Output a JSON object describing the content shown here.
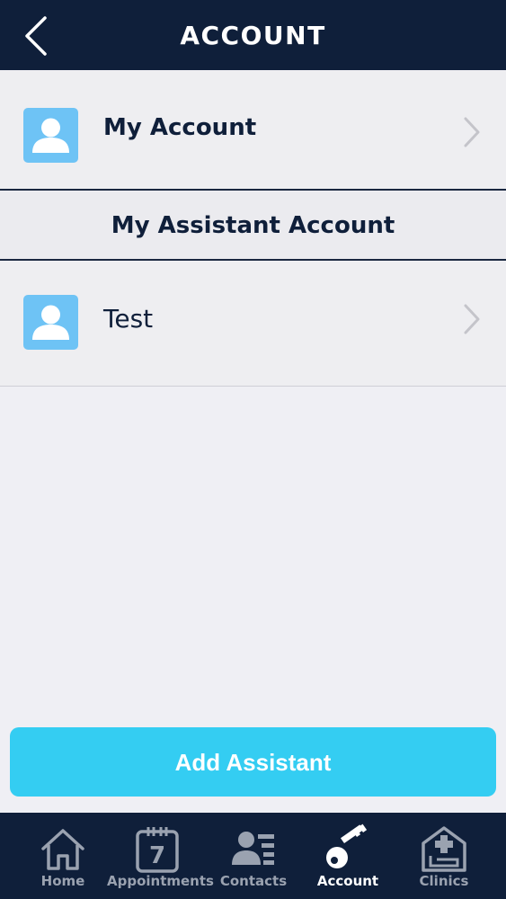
{
  "header": {
    "title": "ACCOUNT"
  },
  "my_account": {
    "label": "My Account"
  },
  "section": {
    "title": "My Assistant Account"
  },
  "assistants": [
    {
      "label": "Test"
    }
  ],
  "add_button": {
    "label": "Add Assistant"
  },
  "tabbar": {
    "items": [
      {
        "label": "Home",
        "icon": "home-icon"
      },
      {
        "label": "Appointments",
        "icon": "calendar-icon",
        "badge": "7"
      },
      {
        "label": "Contacts",
        "icon": "contacts-icon"
      },
      {
        "label": "Account",
        "icon": "key-icon",
        "active": true
      },
      {
        "label": "Clinics",
        "icon": "clinic-icon"
      }
    ]
  },
  "colors": {
    "navy": "#0f1f3a",
    "accent": "#34cdf2",
    "avatar": "#6ec3f5",
    "inactive_tab": "#9aa2b0"
  }
}
